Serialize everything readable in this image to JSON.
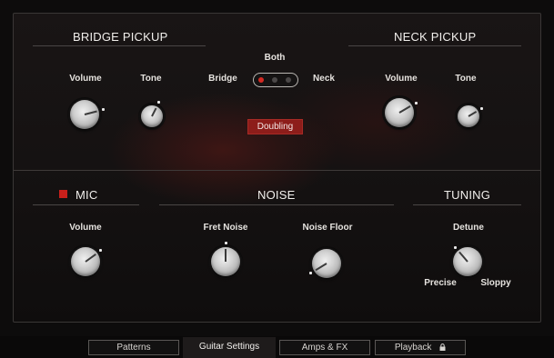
{
  "sections": {
    "bridge_pickup": "BRIDGE PICKUP",
    "neck_pickup": "NECK PICKUP",
    "mic": "MIC",
    "noise": "NOISE",
    "tuning": "TUNING"
  },
  "bridge": {
    "volume_label": "Volume",
    "tone_label": "Tone",
    "volume_value": 0.78,
    "tone_value": 0.6
  },
  "neck": {
    "volume_label": "Volume",
    "tone_label": "Tone",
    "volume_value": 0.72,
    "tone_value": 0.72
  },
  "pickup_selector": {
    "bridge_label": "Bridge",
    "both_label": "Both",
    "neck_label": "Neck",
    "selected": "Bridge"
  },
  "doubling_label": "Doubling",
  "mic": {
    "volume_label": "Volume",
    "volume_value": 0.7,
    "led_color": "#c8201b"
  },
  "noise": {
    "fret_noise_label": "Fret Noise",
    "fret_noise_value": 0.5,
    "noise_floor_label": "Noise Floor",
    "noise_floor_value": 0.05
  },
  "tuning": {
    "detune_label": "Detune",
    "detune_value": 0.35,
    "precise_label": "Precise",
    "sloppy_label": "Sloppy"
  },
  "tabs": [
    {
      "label": "Patterns",
      "active": false
    },
    {
      "label": "Guitar Settings",
      "active": true
    },
    {
      "label": "Amps & FX",
      "active": false
    },
    {
      "label": "Playback",
      "active": false,
      "icon": "lock-icon"
    }
  ],
  "colors": {
    "accent_red": "#8d1d1a",
    "selector_active": "#d42a23"
  }
}
